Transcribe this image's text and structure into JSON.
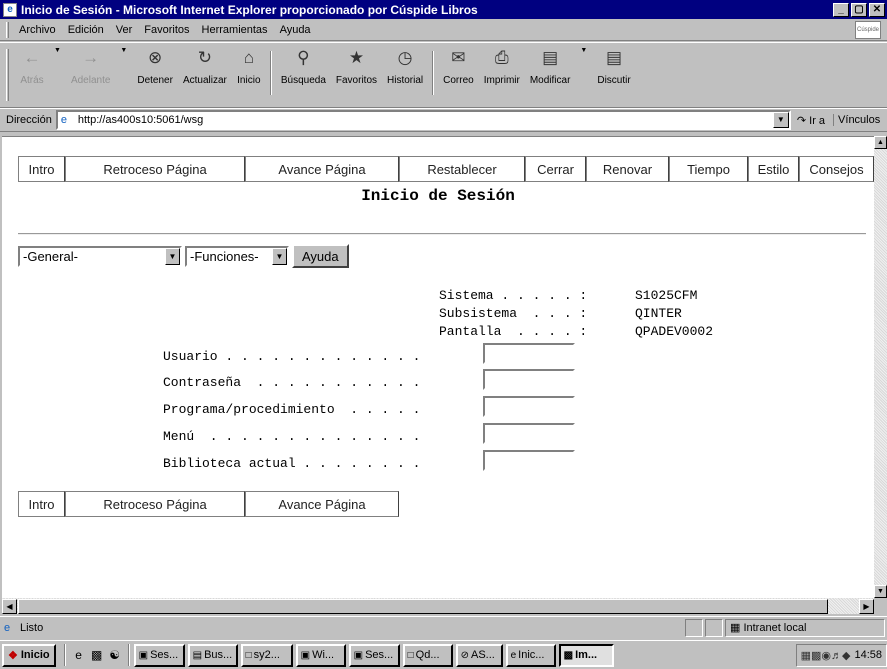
{
  "window": {
    "title": "Inicio de Sesión - Microsoft Internet Explorer proporcionado por Cúspide Libros",
    "buttons": [
      "_",
      "▢",
      "✕"
    ]
  },
  "menu": {
    "items": [
      {
        "label": "Archivo"
      },
      {
        "label": "Edición"
      },
      {
        "label": "Ver"
      },
      {
        "label": "Favoritos"
      },
      {
        "label": "Herramientas"
      },
      {
        "label": "Ayuda"
      }
    ],
    "brand_text": "Cúspide"
  },
  "toolbar": {
    "back": "Atrás",
    "forward": "Adelante",
    "stop": "Detener",
    "refresh": "Actualizar",
    "home": "Inicio",
    "search": "Búsqueda",
    "favorites": "Favoritos",
    "history": "Historial",
    "mail": "Correo",
    "print": "Imprimir",
    "edit": "Modificar",
    "discuss": "Discutir"
  },
  "address": {
    "label": "Dirección",
    "url": "http://as400s10:5061/wsg",
    "go": "Ir a",
    "links": "Vínculos"
  },
  "fkeys_top": [
    "Intro",
    "Retroceso Página",
    "Avance Página",
    "Restablecer",
    "Cerrar",
    "Renovar",
    "Tiempo",
    "Estilo",
    "Consejos"
  ],
  "fkeys_bottom": [
    "Intro",
    "Retroceso Página",
    "Avance Página"
  ],
  "heading": "Inicio de Sesión",
  "selects": {
    "general": "-General-",
    "functions": "-Funciones-",
    "help_button": "Ayuda"
  },
  "system_info": [
    {
      "label": "Sistema . . . . . :",
      "value": "S1025CFM"
    },
    {
      "label": "Subsistema  . . . :",
      "value": "QINTER"
    },
    {
      "label": "Pantalla  . . . . :",
      "value": "QPADEV0002"
    }
  ],
  "login_fields": [
    {
      "label": "Usuario . . . . . . . . . . . . .",
      "value": ""
    },
    {
      "label": "Contraseña  . . . . . . . . . . .",
      "value": ""
    },
    {
      "label": "Programa/procedimiento  . . . . .",
      "value": ""
    },
    {
      "label": "Menú  . . . . . . . . . . . . . .",
      "value": ""
    },
    {
      "label": "Biblioteca actual . . . . . . . .",
      "value": ""
    }
  ],
  "status": {
    "text": "Listo",
    "zone": "Intranet local"
  },
  "taskbar": {
    "start": "Inicio",
    "tasks": [
      {
        "label": "Ses...",
        "active": false
      },
      {
        "label": "Bus...",
        "active": false
      },
      {
        "label": "sy2...",
        "active": false
      },
      {
        "label": "Wi...",
        "active": false
      },
      {
        "label": "Ses...",
        "active": false
      },
      {
        "label": "Qd...",
        "active": false
      },
      {
        "label": "AS...",
        "active": false
      },
      {
        "label": "Inic...",
        "active": false
      },
      {
        "label": "Im...",
        "active": true
      }
    ],
    "clock": "14:58"
  }
}
